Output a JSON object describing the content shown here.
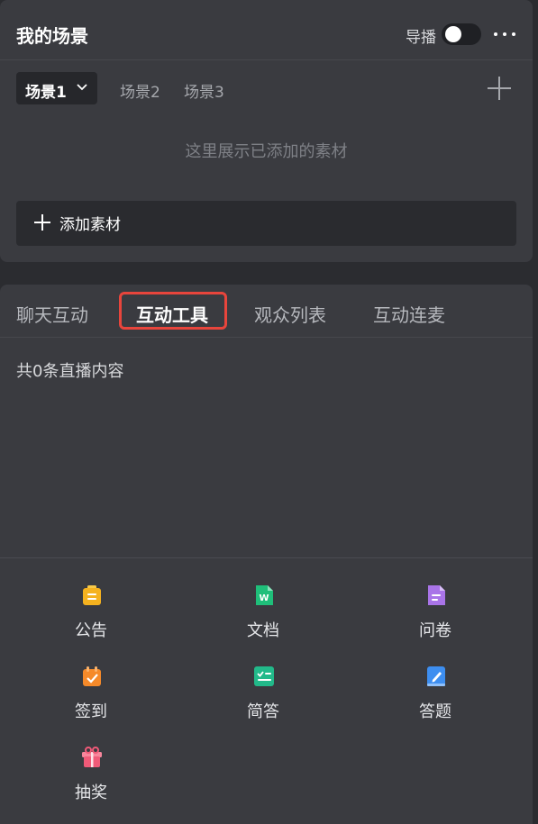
{
  "scene": {
    "title": "我的场景",
    "director_label": "导播",
    "tabs": [
      {
        "label": "场景1",
        "active": true
      },
      {
        "label": "场景2",
        "active": false
      },
      {
        "label": "场景3",
        "active": false
      }
    ],
    "placeholder": "这里展示已添加的素材",
    "add_material_label": "添加素材"
  },
  "interact": {
    "tabs": [
      {
        "label": "聊天互动",
        "active": false
      },
      {
        "label": "互动工具",
        "active": true
      },
      {
        "label": "观众列表",
        "active": false
      },
      {
        "label": "互动连麦",
        "active": false
      }
    ],
    "count_text": "共0条直播内容",
    "tools": [
      {
        "label": "公告",
        "icon": "announcement-icon",
        "color": "#f5b21f"
      },
      {
        "label": "文档",
        "icon": "document-icon",
        "color": "#1fbf7a"
      },
      {
        "label": "问卷",
        "icon": "questionnaire-icon",
        "color": "#a974e8"
      },
      {
        "label": "签到",
        "icon": "checkin-icon",
        "color": "#f58a2a"
      },
      {
        "label": "简答",
        "icon": "short-answer-icon",
        "color": "#22b98a"
      },
      {
        "label": "答题",
        "icon": "quiz-icon",
        "color": "#3d8ef0"
      },
      {
        "label": "抽奖",
        "icon": "lottery-icon",
        "color": "#f05a78"
      }
    ]
  }
}
